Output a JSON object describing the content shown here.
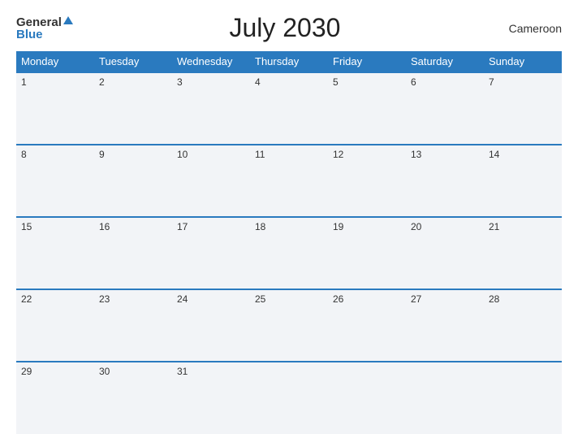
{
  "header": {
    "logo_general": "General",
    "logo_blue": "Blue",
    "month_title": "July 2030",
    "country": "Cameroon"
  },
  "weekdays": [
    "Monday",
    "Tuesday",
    "Wednesday",
    "Thursday",
    "Friday",
    "Saturday",
    "Sunday"
  ],
  "weeks": [
    [
      "1",
      "2",
      "3",
      "4",
      "5",
      "6",
      "7"
    ],
    [
      "8",
      "9",
      "10",
      "11",
      "12",
      "13",
      "14"
    ],
    [
      "15",
      "16",
      "17",
      "18",
      "19",
      "20",
      "21"
    ],
    [
      "22",
      "23",
      "24",
      "25",
      "26",
      "27",
      "28"
    ],
    [
      "29",
      "30",
      "31",
      "",
      "",
      "",
      ""
    ]
  ]
}
